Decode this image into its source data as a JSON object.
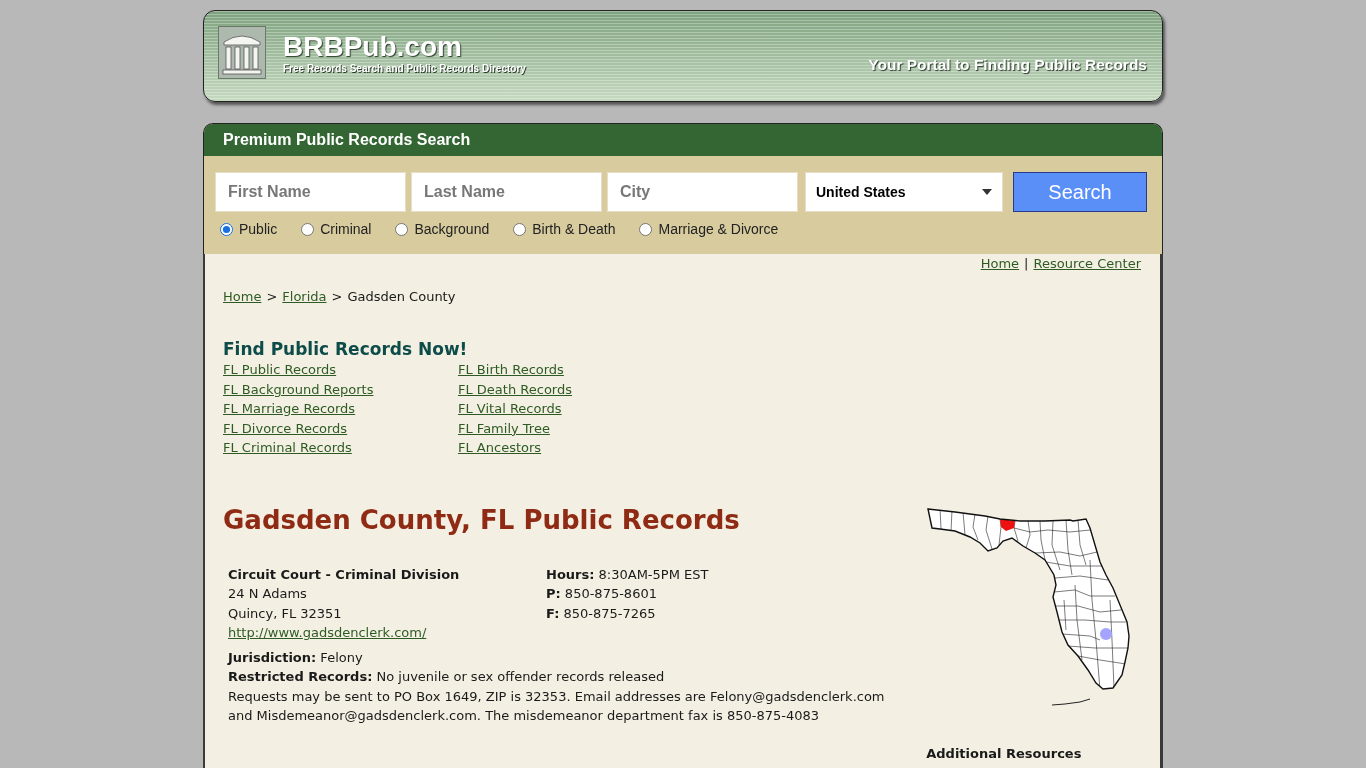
{
  "header": {
    "site_name": "BRBPub.com",
    "tagline": "Free Records Search and Public Records Directory",
    "slogan": "Your Portal to Finding Public Records"
  },
  "search": {
    "title": "Premium Public Records Search",
    "fields": [
      {
        "placeholder": "First Name"
      },
      {
        "placeholder": "Last Name"
      },
      {
        "placeholder": "City"
      }
    ],
    "country": "United States",
    "button": "Search",
    "record_types": [
      {
        "label": "Public",
        "selected": true
      },
      {
        "label": "Criminal",
        "selected": false
      },
      {
        "label": "Background",
        "selected": false
      },
      {
        "label": "Birth & Death",
        "selected": false
      },
      {
        "label": "Marriage & Divorce",
        "selected": false
      }
    ]
  },
  "top_links": {
    "items": [
      "Home",
      "Resource Center"
    ],
    "separator": "|"
  },
  "breadcrumb": {
    "items": [
      {
        "label": "Home",
        "kind": "link"
      },
      {
        "label": "Florida",
        "kind": "link"
      },
      {
        "label": "Gadsden County",
        "kind": "current"
      }
    ],
    "separator": ">"
  },
  "find_records": {
    "title": "Find Public Records Now!",
    "columns": [
      {
        "links": [
          "FL Public Records",
          "FL Background Reports",
          "FL Marriage Records",
          "FL Divorce Records",
          "FL Criminal Records"
        ]
      },
      {
        "links": [
          "FL Birth Records",
          "FL Death Records",
          "FL Vital Records",
          "FL Family Tree",
          "FL Ancestors"
        ]
      }
    ]
  },
  "page_title": "Gadsden County, FL Public Records",
  "offices": [
    {
      "name": "Circuit Court - Criminal Division",
      "address": [
        "24 N Adams",
        "Quincy, FL 32351"
      ],
      "website": "http://www.gadsdenclerk.com/",
      "details": [
        "**Hours:** 8:30AM-5PM EST",
        "**P:** 850-875-8601",
        "**F:** 850-875-7265"
      ],
      "notes": [
        "**Jurisdiction:** Felony",
        "**Restricted Records:** No juvenile or sex offender records released"
      ],
      "description": "Requests may be sent to PO Box 1649, ZIP is 32353. Email addresses are Felony@gadsdenclerk.com and Misdemeanor@gadsdenclerk.com. The misdemeanor department fax is 850-875-4083"
    }
  ],
  "sidebar": {
    "title": "Additional Resources"
  }
}
